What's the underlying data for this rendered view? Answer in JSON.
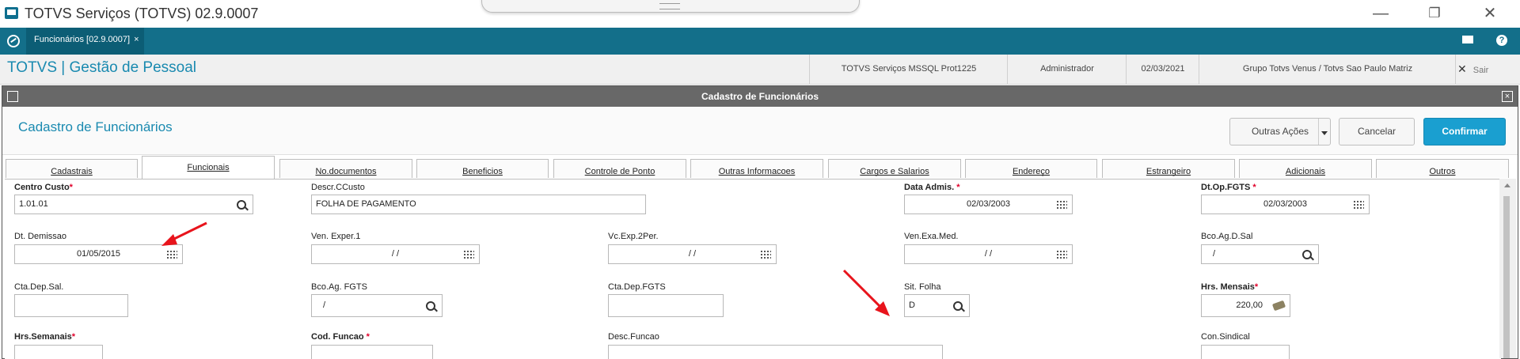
{
  "window": {
    "title": "TOTVS Serviços (TOTVS) 02.9.0007",
    "minimize": "—",
    "restore": "❐",
    "close": "✕"
  },
  "tabbar": {
    "tab_label": "Funcionários [02.9.0007]",
    "tab_close": "×",
    "help": "?"
  },
  "header": {
    "brand": "TOTVS | Gestão de Pessoal",
    "environment": "TOTVS Serviços MSSQL Prot1225",
    "user": "Administrador",
    "date": "02/03/2021",
    "company": "Grupo Totvs Venus / Totvs Sao Paulo Matriz",
    "exit_icon": "✕",
    "exit": "Sair"
  },
  "dialog": {
    "bar_title": "Cadastro de Funcionários",
    "close_glyph": "×",
    "heading": "Cadastro de Funcionários",
    "buttons": {
      "other_actions": "Outras Ações",
      "cancel": "Cancelar",
      "confirm": "Confirmar"
    }
  },
  "folders": [
    "Cadastrais",
    "Funcionais",
    "No.documentos",
    "Beneficios",
    "Controle de Ponto",
    "Outras Informacoes",
    "Cargos e Salarios",
    "Endereço",
    "Estrangeiro",
    "Adicionais",
    "Outros"
  ],
  "active_folder": "Funcionais",
  "fields": {
    "centro_custo": {
      "label": "Centro Custo",
      "required": "*",
      "value": "1.01.01"
    },
    "descr_ccusto": {
      "label": "Descr.CCusto",
      "value": "FOLHA DE PAGAMENTO"
    },
    "data_admis": {
      "label": "Data Admis.",
      "required": "*",
      "value": "02/03/2003"
    },
    "dt_op_fgts": {
      "label": "Dt.Op.FGTS",
      "required": "*",
      "value": "02/03/2003"
    },
    "dt_demissao": {
      "label": "Dt. Demissao",
      "value": "01/05/2015"
    },
    "ven_exper1": {
      "label": "Ven. Exper.1",
      "value": "/ /"
    },
    "vc_exp_2per": {
      "label": "Vc.Exp.2Per.",
      "value": "/ /"
    },
    "ven_exa_med": {
      "label": "Ven.Exa.Med.",
      "value": "/ /"
    },
    "bco_ag_d_sal": {
      "label": "Bco.Ag.D.Sal",
      "value": "/"
    },
    "cta_dep_sal": {
      "label": "Cta.Dep.Sal.",
      "value": ""
    },
    "bco_ag_fgts": {
      "label": "Bco.Ag. FGTS",
      "value": "/"
    },
    "cta_dep_fgts": {
      "label": "Cta.Dep.FGTS",
      "value": ""
    },
    "sit_folha": {
      "label": "Sit. Folha",
      "value": "D"
    },
    "hrs_mensais": {
      "label": "Hrs. Mensais",
      "required": "*",
      "value": "220,00"
    },
    "hrs_semanais": {
      "label": "Hrs.Semanais",
      "required": "*",
      "value": ""
    },
    "cod_funcao": {
      "label": "Cod. Funcao",
      "required": "*",
      "value": ""
    },
    "desc_funcao": {
      "label": "Desc.Funcao",
      "value": ""
    },
    "con_sindical": {
      "label": "Con.Sindical",
      "value": ""
    }
  },
  "colors": {
    "accent": "#136f8a",
    "brand_text": "#1a8ab0",
    "primary_button": "#1a9fd0",
    "annotation_arrow": "#e8141c"
  }
}
